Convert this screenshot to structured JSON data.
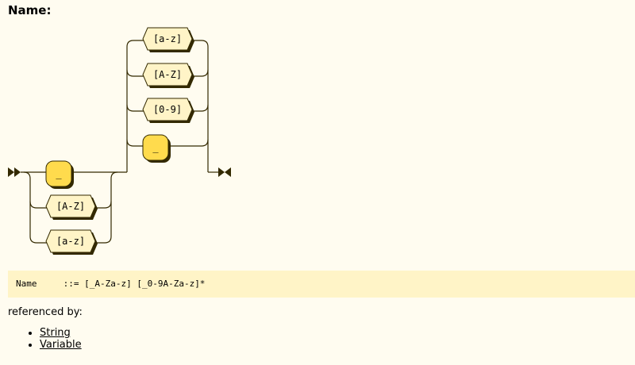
{
  "production": {
    "title": "Name:",
    "ebnf_name": "Name",
    "ebnf_rule": "::= [_A-Za-z] [_0-9A-Za-z]*"
  },
  "diagram": {
    "first_choice": [
      "_",
      "[A-Z]",
      "[a-z]"
    ],
    "loop_choice": [
      "[a-z]",
      "[A-Z]",
      "[0-9]",
      "_"
    ]
  },
  "referenced_by": {
    "label": "referenced by:",
    "items": [
      "String",
      "Variable"
    ]
  },
  "colors": {
    "background": "#FFFCF0",
    "terminal_fill": "#FFDB4D",
    "charclass_fill": "#FFF4C7",
    "stroke": "#332900"
  }
}
